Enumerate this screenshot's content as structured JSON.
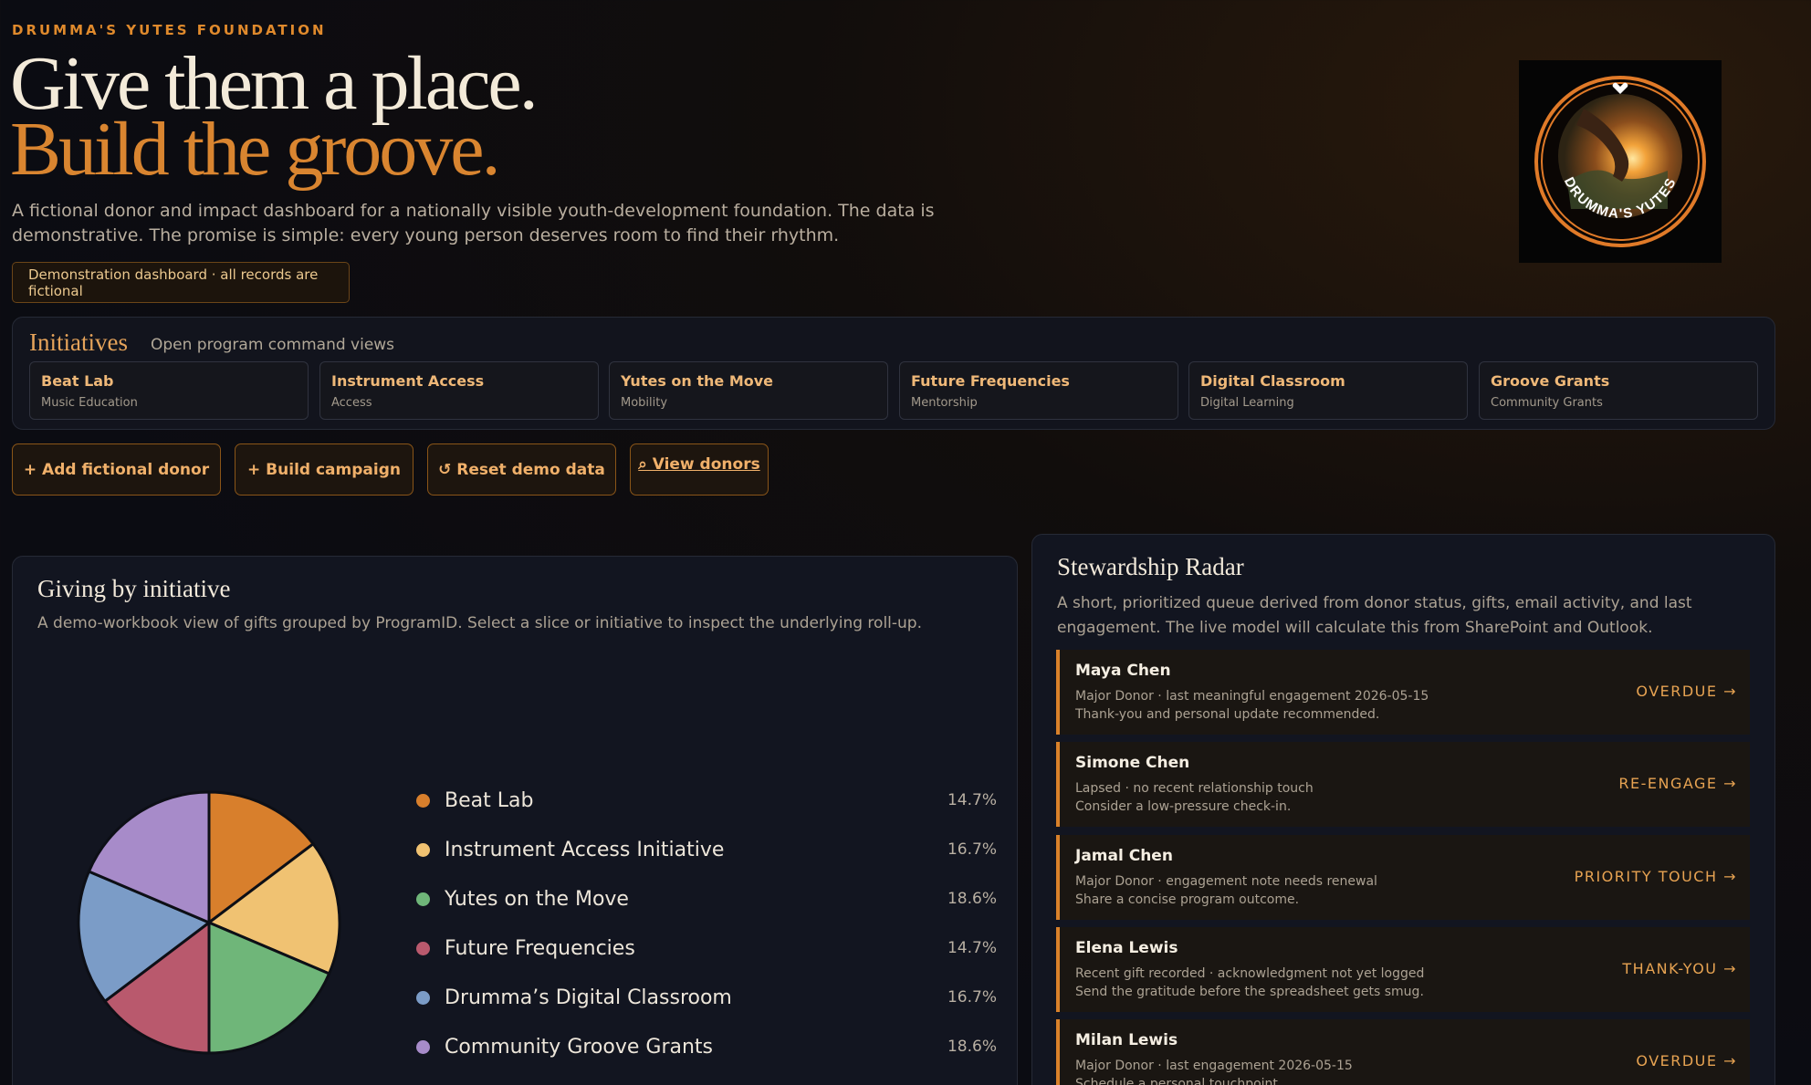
{
  "header": {
    "eyebrow": "DRUMMA'S YUTES FOUNDATION",
    "headline_line1": "Give them a place.",
    "headline_line2": "Build the groove.",
    "intro": "A fictional donor and impact dashboard for a nationally visible youth-development foundation. The data is demonstrative. The promise is simple: every young person deserves room to find their rhythm.",
    "demo_badge": "Demonstration dashboard · all records are fictional",
    "logo_text": "DRUMMA'S YUTES"
  },
  "initiatives": {
    "title": "Initiatives",
    "subtitle": "Open program command views",
    "items": [
      {
        "name": "Beat Lab",
        "category": "Music Education"
      },
      {
        "name": "Instrument Access",
        "category": "Access"
      },
      {
        "name": "Yutes on the Move",
        "category": "Mobility"
      },
      {
        "name": "Future Frequencies",
        "category": "Mentorship"
      },
      {
        "name": "Digital Classroom",
        "category": "Digital Learning"
      },
      {
        "name": "Groove Grants",
        "category": "Community Grants"
      }
    ]
  },
  "actions": {
    "add_donor": "+ Add fictional donor",
    "build_campaign": "+ Build campaign",
    "reset": "↺ Reset demo data",
    "view_donors": "⌕ View donors"
  },
  "giving": {
    "title": "Giving by initiative",
    "description": "A demo-workbook view of gifts grouped by ProgramID. Select a slice or initiative to inspect the underlying roll-up."
  },
  "chart_data": {
    "type": "pie",
    "categories": [
      "Beat Lab",
      "Instrument Access Initiative",
      "Yutes on the Move",
      "Future Frequencies",
      "Drumma’s Digital Classroom",
      "Community Groove Grants"
    ],
    "values": [
      14.7,
      16.7,
      18.6,
      14.7,
      16.7,
      18.6
    ],
    "labels": [
      "14.7%",
      "16.7%",
      "18.6%",
      "14.7%",
      "16.7%",
      "18.6%"
    ],
    "colors": [
      "#d87f2c",
      "#f0c272",
      "#6fb679",
      "#b9596d",
      "#7b9cc7",
      "#a78bc9"
    ],
    "legend": "right"
  },
  "stewardship": {
    "title": "Stewardship Radar",
    "description": "A short, prioritized queue derived from donor status, gifts, email activity, and last engagement. The live model will calculate this from SharePoint and Outlook.",
    "items": [
      {
        "name": "Maya Chen",
        "line1": "Major Donor · last meaningful engagement 2026-05-15",
        "line2": "Thank-you and personal update recommended.",
        "tag": "OVERDUE →"
      },
      {
        "name": "Simone Chen",
        "line1": "Lapsed · no recent relationship touch",
        "line2": "Consider a low-pressure check-in.",
        "tag": "RE-ENGAGE →"
      },
      {
        "name": "Jamal Chen",
        "line1": "Major Donor · engagement note needs renewal",
        "line2": "Share a concise program outcome.",
        "tag": "PRIORITY TOUCH →"
      },
      {
        "name": "Elena Lewis",
        "line1": "Recent gift recorded · acknowledgment not yet logged",
        "line2": "Send the gratitude before the spreadsheet gets smug.",
        "tag": "THANK-YOU →"
      },
      {
        "name": "Milan Lewis",
        "line1": "Major Donor · last engagement 2026-05-15",
        "line2": "Schedule a personal touchpoint.",
        "tag": "OVERDUE →"
      }
    ]
  }
}
